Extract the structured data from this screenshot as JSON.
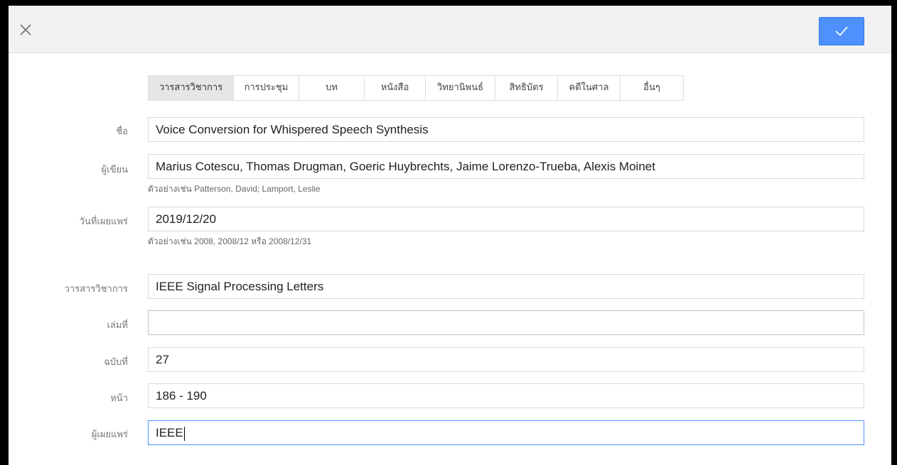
{
  "toolbar": {
    "close_icon": "close-icon",
    "confirm_icon": "check-icon",
    "accent": "#4d90fe"
  },
  "tabs": [
    {
      "label": "วารสารวิชาการ",
      "active": true
    },
    {
      "label": "การประชุม"
    },
    {
      "label": "บท"
    },
    {
      "label": "หนังสือ"
    },
    {
      "label": "วิทยานิพนธ์"
    },
    {
      "label": "สิทธิบัตร"
    },
    {
      "label": "คดีในศาล"
    },
    {
      "label": "อื่นๆ"
    }
  ],
  "form": {
    "title": {
      "label": "ชื่อ",
      "value": "Voice Conversion for Whispered Speech Synthesis"
    },
    "authors": {
      "label": "ผู้เขียน",
      "value": "Marius Cotescu, Thomas Drugman, Goeric Huybrechts, Jaime Lorenzo-Trueba, Alexis Moinet",
      "hint": "ตัวอย่างเช่น Patterson, David; Lamport, Leslie"
    },
    "date": {
      "label": "วันที่เผยแพร่",
      "value": "2019/12/20",
      "hint": "ตัวอย่างเช่น 2008, 2008/12 หรือ 2008/12/31"
    },
    "journal": {
      "label": "วารสารวิชาการ",
      "value": "IEEE Signal Processing Letters"
    },
    "volume": {
      "label": "เล่มที่",
      "value": ""
    },
    "issue": {
      "label": "ฉบับที่",
      "value": "27"
    },
    "pages": {
      "label": "หน้า",
      "value": "186 - 190"
    },
    "publisher": {
      "label": "ผู้เผยแพร่",
      "value": "IEEE"
    }
  }
}
